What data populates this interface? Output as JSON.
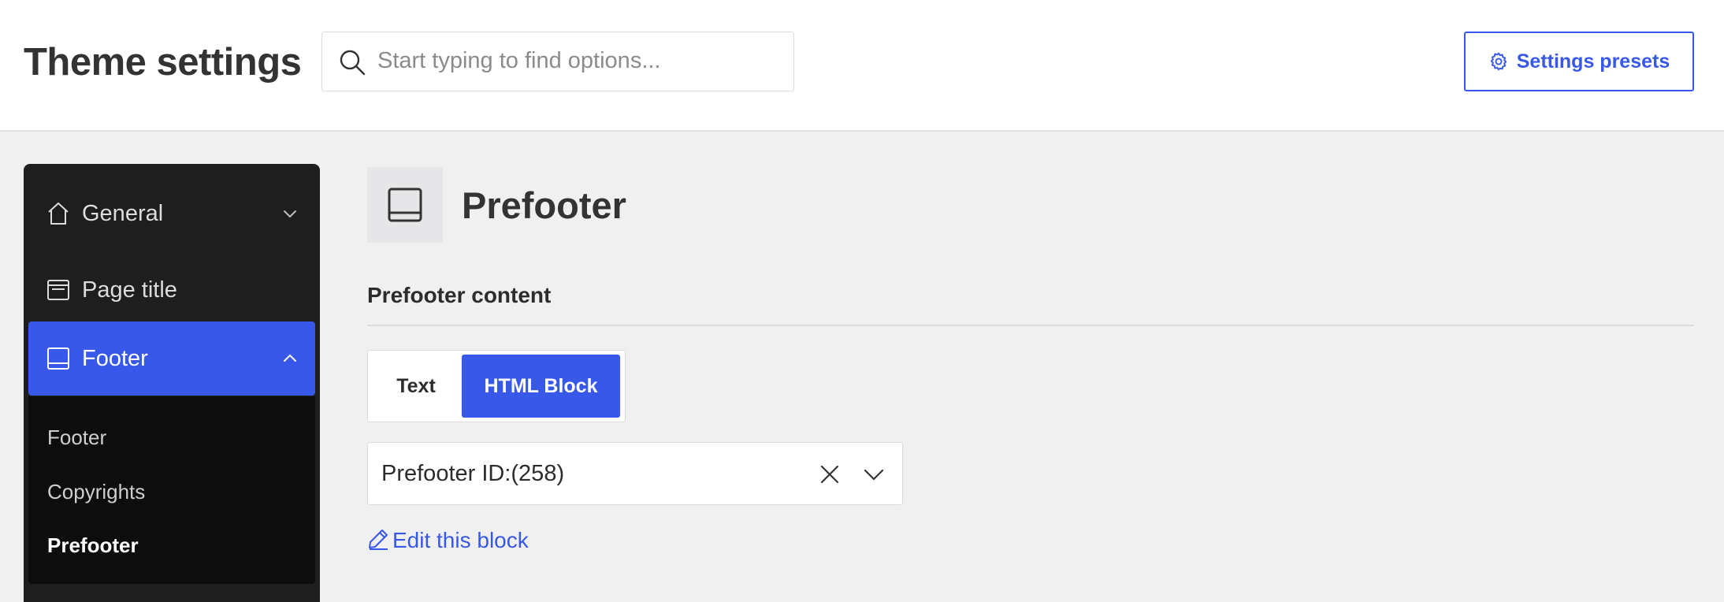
{
  "header": {
    "title": "Theme settings",
    "search_placeholder": "Start typing to find options...",
    "presets_label": "Settings presets"
  },
  "sidebar": {
    "items": [
      {
        "label": "General",
        "icon": "home-icon",
        "expanded": false
      },
      {
        "label": "Page title",
        "icon": "page-title-icon"
      },
      {
        "label": "Footer",
        "icon": "footer-icon",
        "expanded": true,
        "active": true
      }
    ],
    "submenu": [
      {
        "label": "Footer"
      },
      {
        "label": "Copyrights"
      },
      {
        "label": "Prefooter",
        "current": true
      }
    ]
  },
  "main": {
    "section_title": "Prefooter",
    "section_icon": "footer-icon",
    "field_label": "Prefooter content",
    "toggle": {
      "options": [
        "Text",
        "HTML Block"
      ],
      "selected": "HTML Block"
    },
    "select_value": "Prefooter ID:(258)",
    "edit_link": "Edit this block"
  },
  "colors": {
    "accent": "#3858e9",
    "sidebar_bg": "#1e1e1e",
    "submenu_bg": "#0d0d0d",
    "page_bg": "#f0f0f1"
  }
}
